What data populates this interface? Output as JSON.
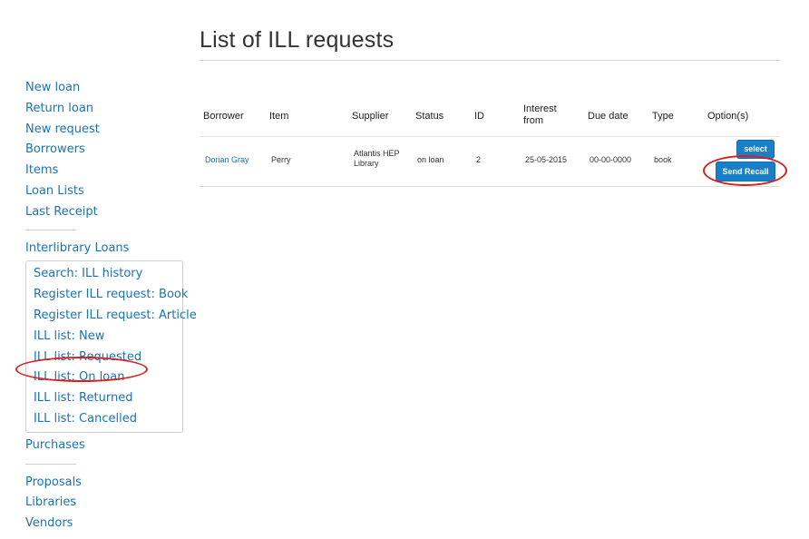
{
  "page": {
    "title": "List of ILL requests"
  },
  "sidebar": {
    "main": [
      "New loan",
      "Return loan",
      "New request",
      "Borrowers",
      "Items",
      "Loan Lists",
      "Last Receipt"
    ],
    "ill_header": "Interlibrary Loans",
    "ill_items": [
      "Search: ILL history",
      "Register ILL request: Book",
      "Register ILL request: Article",
      "ILL list: New",
      "ILL list: Requested",
      "ILL list: On loan",
      "ILL list: Returned",
      "ILL list: Cancelled"
    ],
    "purchases": "Purchases",
    "bottom": [
      "Proposals",
      "Libraries",
      "Vendors"
    ]
  },
  "table": {
    "headers": [
      "Borrower",
      "Item",
      "Supplier",
      "Status",
      "ID",
      "Interest from",
      "Due date",
      "Type",
      "Option(s)"
    ],
    "rows": [
      {
        "borrower": "Dorian Gray",
        "item": "Perry",
        "supplier": "Atlantis HEP Library",
        "status": "on loan",
        "id": "2",
        "interest_from": "25-05-2015",
        "due_date": "00-00-0000",
        "type": "book",
        "select_label": "select",
        "recall_label": "Send Recall"
      }
    ]
  },
  "colors": {
    "link": "#1a73b8",
    "button": "#1a7fc9",
    "highlight": "#d82020"
  }
}
